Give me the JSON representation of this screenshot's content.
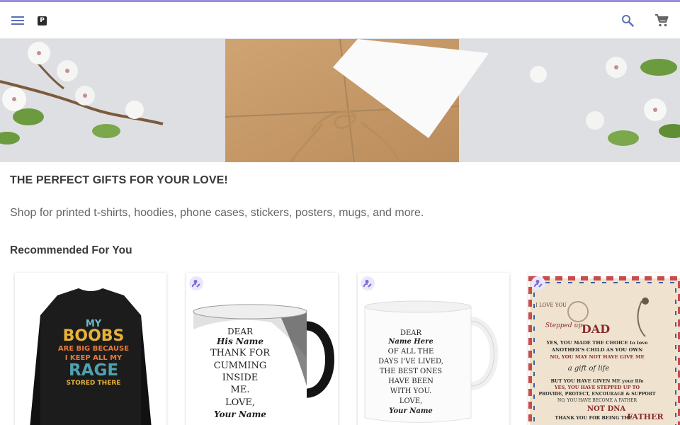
{
  "header": {
    "logo_letter": "P",
    "accent_color": "#9b8ee0",
    "icons": [
      "menu-icon",
      "search-icon",
      "cart-icon"
    ]
  },
  "main": {
    "headline": "THE PERFECT GIFTS FOR YOUR LOVE!",
    "subline": "Shop for printed t-shirts, hoodies, phone cases, stickers, posters, mugs, and more.",
    "recommended_title": "Recommended For You"
  },
  "products": [
    {
      "type": "long-sleeve-shirt",
      "personalizable": false,
      "print": [
        "MY",
        "BOOBS",
        "ARE BIG BECAUSE",
        "I KEEP ALL MY",
        "RAGE",
        "STORED THERE"
      ]
    },
    {
      "type": "mug",
      "personalizable": true,
      "print": [
        "DEAR",
        "His Name",
        "THANK FOR",
        "CUMMING",
        "INSIDE",
        "ME.",
        "LOVE,",
        "Your Name"
      ]
    },
    {
      "type": "mug",
      "personalizable": true,
      "print": [
        "DEAR",
        "Name Here",
        "OF ALL THE",
        "DAYS I'VE LIVED,",
        "THE BEST ONES",
        "HAVE BEEN",
        "WITH YOU.",
        "LOVE,",
        "Your Name"
      ]
    },
    {
      "type": "blanket",
      "personalizable": true,
      "print": [
        "I LOVE YOU",
        "Stepped up",
        "DAD",
        "YES, YOU MADE THE CHOICE to love",
        "ANOTHER'S CHILD AS YOU OWN",
        "NO, YOU MAY NOT HAVE GIVE ME",
        "a gift of life",
        "BUT YOU HAVE GIVEN ME your life",
        "YES, YOU HAVE STEPPED UP TO",
        "PROVIDE, PROTECT, ENCOURAGE & SUPPORT",
        "NO, YOU HAVE BECOME A FATHER",
        "NOT DNA",
        "THANK YOU FOR BEING THE",
        "FATHER"
      ]
    }
  ]
}
